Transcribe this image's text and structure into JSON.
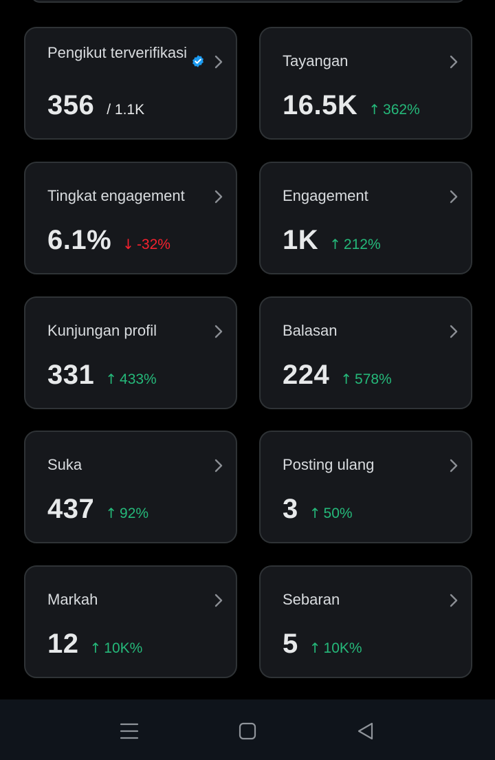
{
  "cards": [
    {
      "title": "Pengikut terverifikasi",
      "value": "356",
      "secondary": "/ 1.1K",
      "delta": "",
      "direction": "none",
      "verified_icon": "verified-badge-icon"
    },
    {
      "title": "Tayangan",
      "value": "16.5K",
      "secondary": "",
      "delta": "362%",
      "direction": "up"
    },
    {
      "title": "Tingkat engagement",
      "value": "6.1%",
      "secondary": "",
      "delta": "-32%",
      "direction": "down"
    },
    {
      "title": "Engagement",
      "value": "1K",
      "secondary": "",
      "delta": "212%",
      "direction": "up"
    },
    {
      "title": "Kunjungan profil",
      "value": "331",
      "secondary": "",
      "delta": "433%",
      "direction": "up"
    },
    {
      "title": "Balasan",
      "value": "224",
      "secondary": "",
      "delta": "578%",
      "direction": "up"
    },
    {
      "title": "Suka",
      "value": "437",
      "secondary": "",
      "delta": "92%",
      "direction": "up"
    },
    {
      "title": "Posting ulang",
      "value": "3",
      "secondary": "",
      "delta": "50%",
      "direction": "up"
    },
    {
      "title": "Markah",
      "value": "12",
      "secondary": "",
      "delta": "10K%",
      "direction": "up"
    },
    {
      "title": "Sebaran",
      "value": "5",
      "secondary": "",
      "delta": "10K%",
      "direction": "up"
    }
  ],
  "icons": {
    "chevron": "chevron-right-icon",
    "arrow_up": "↑",
    "arrow_down": "↓"
  },
  "nav": {
    "recents": "menu-icon",
    "home": "home-square-icon",
    "back": "back-triangle-icon"
  },
  "colors": {
    "background": "#000000",
    "card_background": "#16181c",
    "card_border": "#2f3336",
    "text_primary": "#e7e9ea",
    "positive": "#25b97a",
    "negative": "#f4212e",
    "verified": "#1d9bf0",
    "nav_bar": "#0f141b"
  }
}
